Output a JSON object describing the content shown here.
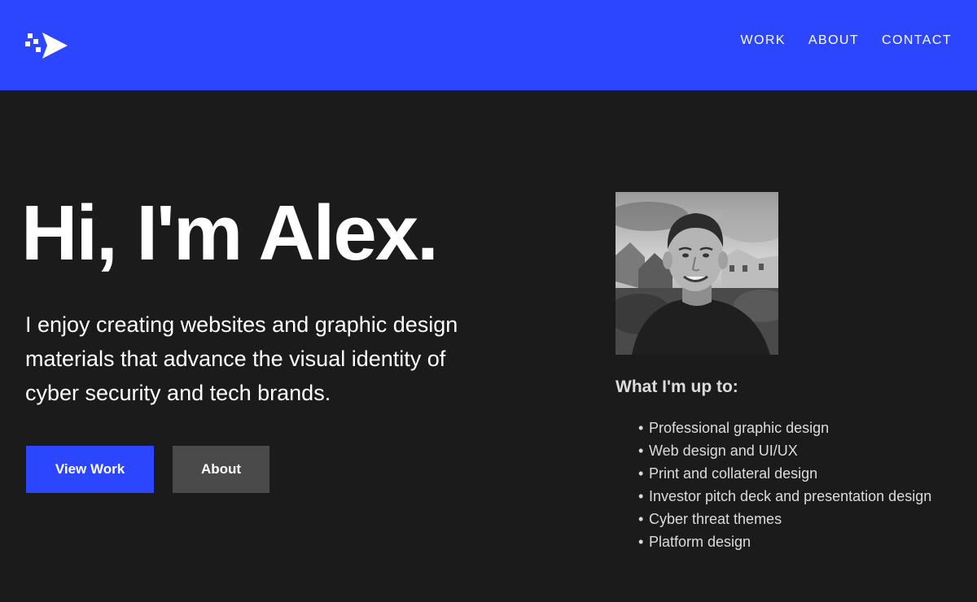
{
  "header": {
    "logo_icon": "pixel-arrow-logo-icon",
    "background_color": "#2c45ff",
    "nav": [
      {
        "label": "WORK"
      },
      {
        "label": "ABOUT"
      },
      {
        "label": "CONTACT"
      }
    ]
  },
  "hero": {
    "title": "Hi, I'm Alex.",
    "subtitle": "I enjoy creating websites and graphic design materials that advance the visual identity of cyber security and tech brands.",
    "buttons": {
      "primary_label": "View Work",
      "secondary_label": "About"
    }
  },
  "profile": {
    "photo_icon": "profile-photo",
    "photo_alt": "Portrait of Alex"
  },
  "upto": {
    "title": "What I'm up to:",
    "items": [
      "Professional graphic design",
      "Web design and UI/UX",
      "Print and collateral design",
      "Investor pitch deck and presentation design",
      "Cyber threat themes",
      "Platform design"
    ]
  },
  "colors": {
    "accent": "#2c45ff",
    "page_background": "#1b1b1b",
    "secondary_button": "#4a4a4a",
    "text": "#ffffff",
    "muted_text": "#dcdcdc"
  }
}
